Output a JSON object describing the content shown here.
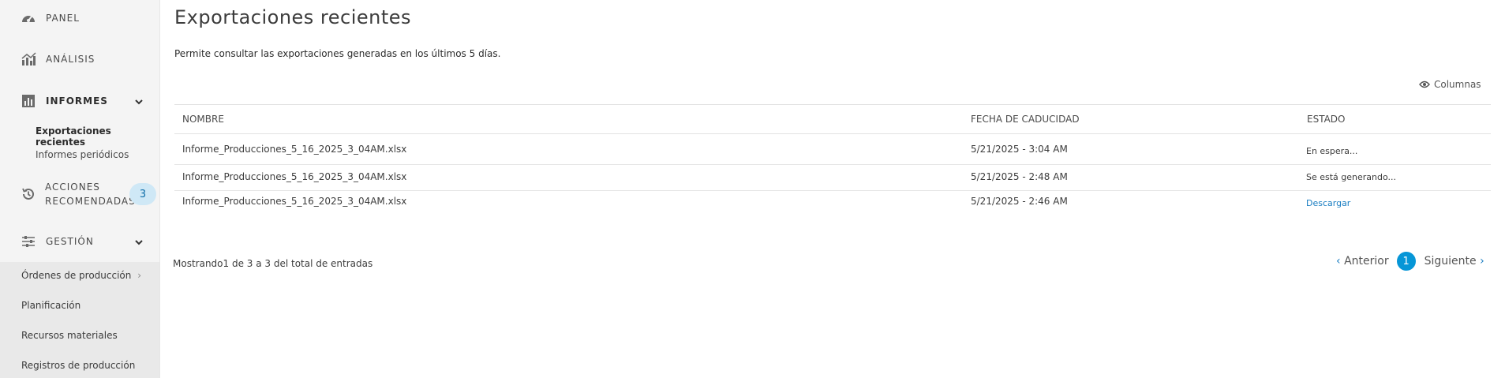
{
  "sidebar": {
    "items": [
      {
        "label": "PANEL",
        "icon": "speedometer-icon"
      },
      {
        "label": "ANÁLISIS",
        "icon": "bar-chart-icon"
      },
      {
        "label": "INFORMES",
        "icon": "report-icon"
      },
      {
        "label_line1": "ACCIONES",
        "label_line2": "RECOMENDADAS",
        "icon": "history-icon",
        "badge": "3"
      },
      {
        "label": "GESTIÓN",
        "icon": "sliders-icon"
      }
    ],
    "informes_sub": [
      "Exportaciones recientes",
      "Informes periódicos"
    ],
    "gestion_sub": [
      "Órdenes de producción",
      "Planificación",
      "Recursos materiales",
      "Registros de producción"
    ]
  },
  "main": {
    "title": "Exportaciones recientes",
    "description": "Permite consultar las exportaciones generadas en los últimos 5 días.",
    "columns_label": "Columnas",
    "headers": [
      "NOMBRE",
      "FECHA DE CADUCIDAD",
      "ESTADO"
    ],
    "rows": [
      {
        "name": "Informe_Producciones_5_16_2025_3_04AM.xlsx",
        "expiry": "5/21/2025 - 3:04 AM",
        "status": "En espera..."
      },
      {
        "name": "Informe_Producciones_5_16_2025_3_04AM.xlsx",
        "expiry": "5/21/2025 - 2:48 AM",
        "status": "Se está generando..."
      },
      {
        "name": "Informe_Producciones_5_16_2025_3_04AM.xlsx",
        "expiry": "5/21/2025 - 2:46 AM",
        "status": "Descargar"
      }
    ],
    "footer": "Mostrando1 de 3   a 3   del total de entradas",
    "pager": {
      "prev": "Anterior",
      "page": "1",
      "next": "Siguiente"
    }
  },
  "colors": {
    "accent": "#0696d7",
    "link": "#1a7ec2",
    "badge_bg": "#cfe8f6"
  }
}
